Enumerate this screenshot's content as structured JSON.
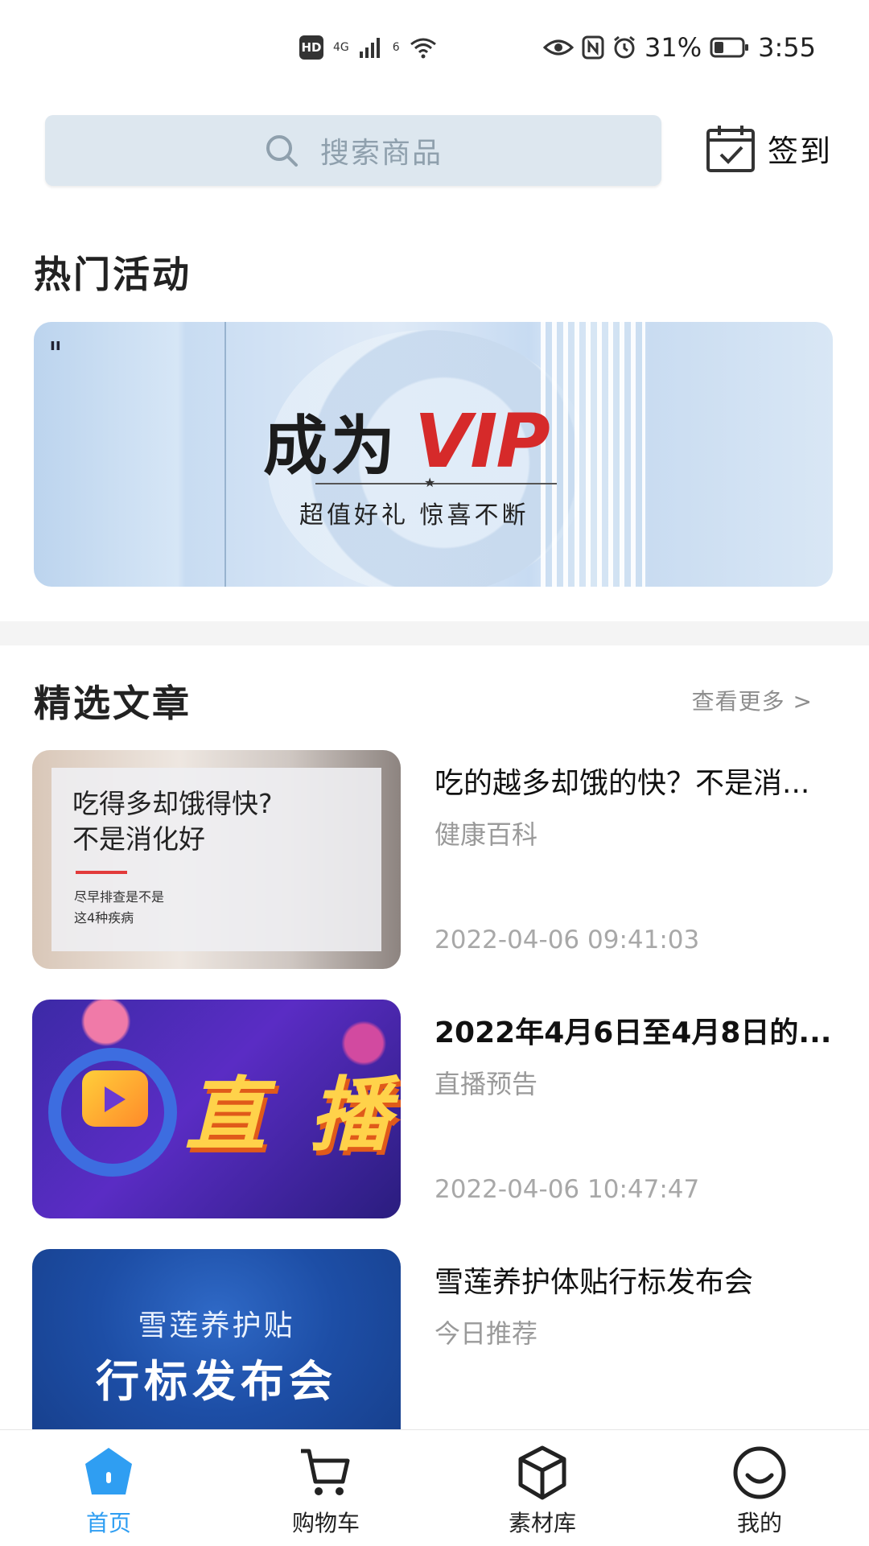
{
  "status_bar": {
    "network_badge": "HD",
    "network_type": "4G",
    "wifi_tag": "6",
    "battery": "31%",
    "time": "3:55"
  },
  "search": {
    "placeholder": "搜索商品"
  },
  "checkin": {
    "label": "签到"
  },
  "hot": {
    "title": "热门活动",
    "banner": {
      "main": "成为",
      "vip": "VIP",
      "subtitle": "超值好礼  惊喜不断"
    }
  },
  "articles_section": {
    "title": "精选文章",
    "more": "查看更多 >"
  },
  "articles": [
    {
      "title": "吃的越多却饿的快？不是消...",
      "category": "健康百科",
      "time": "2022-04-06 09:41:03",
      "thumb_text": [
        "吃得多却饿得快?",
        "不是消化好",
        "尽早排查是不是",
        "这4种疾病"
      ]
    },
    {
      "title": "2022年4月6日至4月8日的...",
      "category": "直播预告",
      "time": "2022-04-06 10:47:47",
      "thumb_text": [
        "直 播"
      ]
    },
    {
      "title": "雪莲养护体贴行标发布会",
      "category": "今日推荐",
      "time": "",
      "thumb_text": [
        "雪莲养护贴",
        "行标发布会"
      ]
    }
  ],
  "nav": [
    {
      "label": "首页",
      "icon": "home-icon",
      "active": true
    },
    {
      "label": "购物车",
      "icon": "cart-icon",
      "active": false
    },
    {
      "label": "素材库",
      "icon": "cube-icon",
      "active": false
    },
    {
      "label": "我的",
      "icon": "smile-icon",
      "active": false
    }
  ],
  "colors": {
    "accent": "#2f9ef2",
    "search_bg": "#dde7ef",
    "vip_red": "#d62a2a"
  }
}
